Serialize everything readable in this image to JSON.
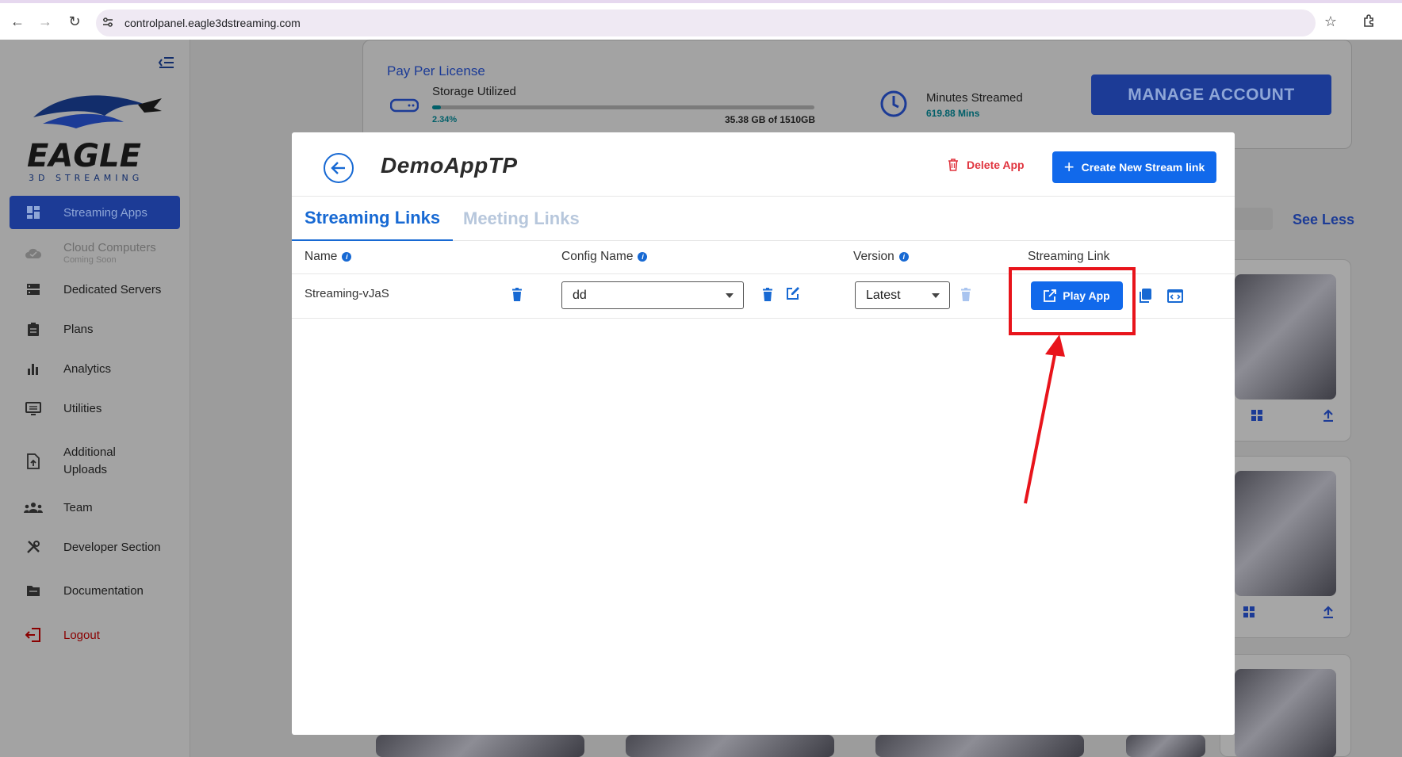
{
  "browser": {
    "url": "controlpanel.eagle3dstreaming.com"
  },
  "sidebar": {
    "logo_word": "EAGLE",
    "logo_sub": "3D STREAMING",
    "items": [
      {
        "label": "Streaming Apps",
        "icon": "dashboard-icon"
      },
      {
        "label": "Cloud Computers",
        "sub": "Coming Soon",
        "icon": "cloud-icon"
      },
      {
        "label": "Dedicated Servers",
        "icon": "server-icon"
      },
      {
        "label": "Plans",
        "icon": "clipboard-icon"
      },
      {
        "label": "Analytics",
        "icon": "bar-chart-icon"
      },
      {
        "label": "Utilities",
        "icon": "monitor-icon"
      },
      {
        "label": "Additional Uploads",
        "icon": "file-upload-icon"
      },
      {
        "label": "Team",
        "icon": "team-icon"
      },
      {
        "label": "Developer Section",
        "icon": "tools-icon"
      },
      {
        "label": "Documentation",
        "icon": "folder-icon"
      },
      {
        "label": "Logout",
        "icon": "logout-icon"
      }
    ]
  },
  "background": {
    "license_title": "Pay Per License",
    "storage_label": "Storage Utilized",
    "storage_percent_text": "2.34%",
    "storage_fraction": 0.0234,
    "storage_amount": "35.38 GB of 1510GB",
    "minutes_label": "Minutes Streamed",
    "minutes_value": "619.88 Mins",
    "manage_button": "MANAGE ACCOUNT",
    "see_less": "See Less"
  },
  "modal": {
    "app_name": "DemoAppTP",
    "delete_app": "Delete App",
    "create_link": "Create New Stream link",
    "tabs": [
      {
        "label": "Streaming Links",
        "active": true
      },
      {
        "label": "Meeting Links",
        "active": false
      }
    ],
    "columns": {
      "name": "Name",
      "config": "Config Name",
      "version": "Version",
      "link": "Streaming Link"
    },
    "rows": [
      {
        "name": "Streaming-vJaS",
        "config": "dd",
        "version": "Latest",
        "play_label": "Play App"
      }
    ]
  },
  "colors": {
    "primary": "#1169eb",
    "danger": "#e0353f",
    "annotation": "#e8141b"
  }
}
